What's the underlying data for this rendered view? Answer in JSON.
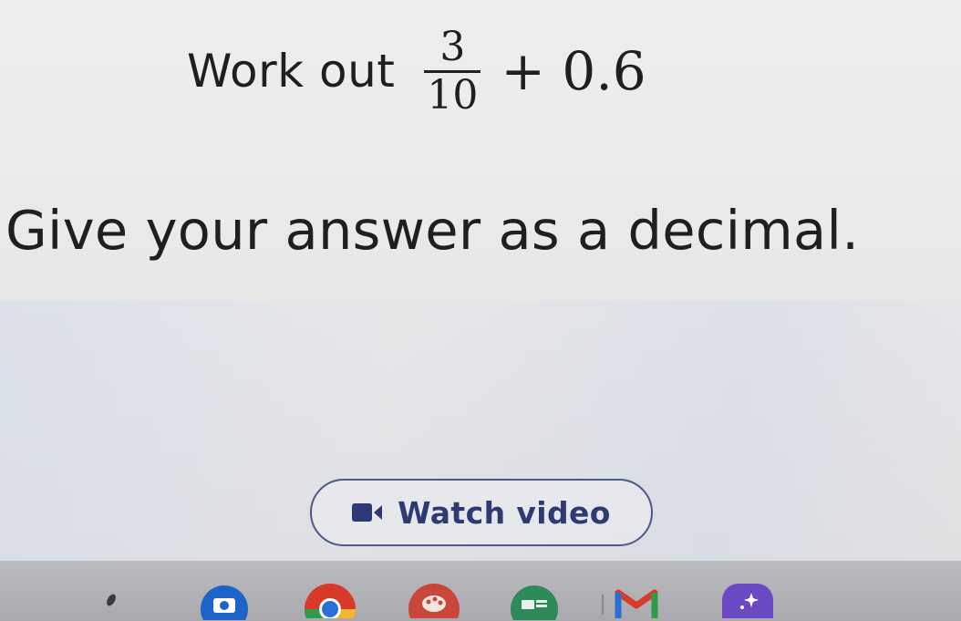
{
  "question": {
    "label": "Work out",
    "numerator": "3",
    "denominator": "10",
    "rest": "+ 0.6"
  },
  "instruction": "Give your answer as a decimal.",
  "video_button": {
    "label": "Watch video",
    "icon": "video-camera-icon",
    "accent": "#2e3a73"
  },
  "shelf": {
    "apps": [
      {
        "name": "pen-icon"
      },
      {
        "name": "camera-icon"
      },
      {
        "name": "chrome-icon"
      },
      {
        "name": "palette-icon"
      },
      {
        "name": "docs-icon"
      },
      {
        "name": "gmail-icon"
      },
      {
        "name": "sparkle-app-icon"
      }
    ]
  }
}
